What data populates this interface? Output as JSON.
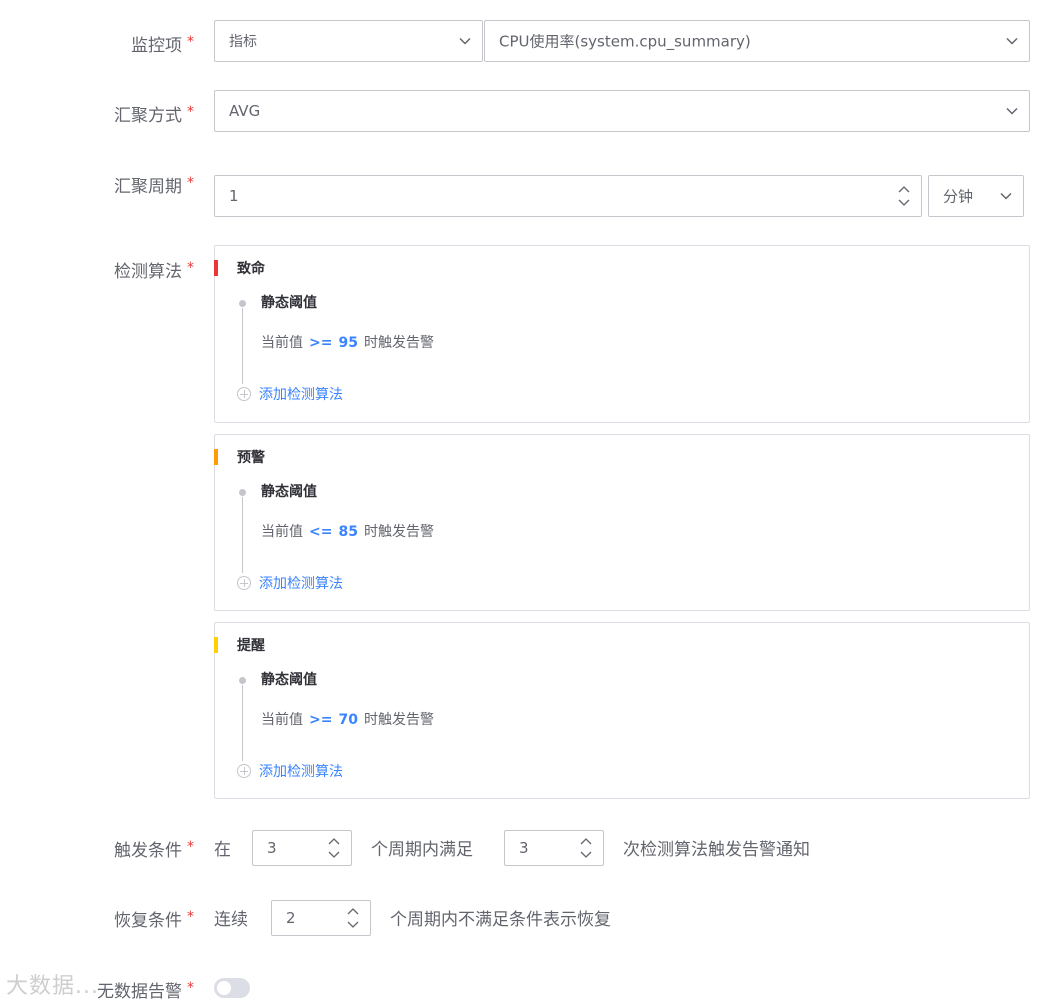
{
  "form": {
    "metric": {
      "label": "监控项",
      "type_value": "指标",
      "metric_value": "CPU使用率(system.cpu_summary)"
    },
    "aggregation": {
      "label": "汇聚方式",
      "value": "AVG"
    },
    "period": {
      "label": "汇聚周期",
      "value": "1",
      "unit": "分钟"
    },
    "detection": {
      "label": "检测算法",
      "levels": [
        {
          "name": "致命",
          "color": "#ea3636",
          "algorithm": "静态阈值",
          "prefix": "当前值",
          "operator": ">=",
          "threshold": "95",
          "suffix": "时触发告警",
          "add_label": "添加检测算法"
        },
        {
          "name": "预警",
          "color": "#ff9c01",
          "algorithm": "静态阈值",
          "prefix": "当前值",
          "operator": "<=",
          "threshold": "85",
          "suffix": "时触发告警",
          "add_label": "添加检测算法"
        },
        {
          "name": "提醒",
          "color": "#ffd000",
          "algorithm": "静态阈值",
          "prefix": "当前值",
          "operator": ">=",
          "threshold": "70",
          "suffix": "时触发告警",
          "add_label": "添加检测算法"
        }
      ]
    },
    "trigger": {
      "label": "触发条件",
      "text1": "在",
      "value1": "3",
      "text2": "个周期内满足",
      "value2": "3",
      "text3": "次检测算法触发告警通知"
    },
    "recovery": {
      "label": "恢复条件",
      "text1": "连续",
      "value": "2",
      "text2": "个周期内不满足条件表示恢复"
    },
    "nodata": {
      "label": "无数据告警",
      "enabled": false
    }
  },
  "watermark": "大数据..."
}
